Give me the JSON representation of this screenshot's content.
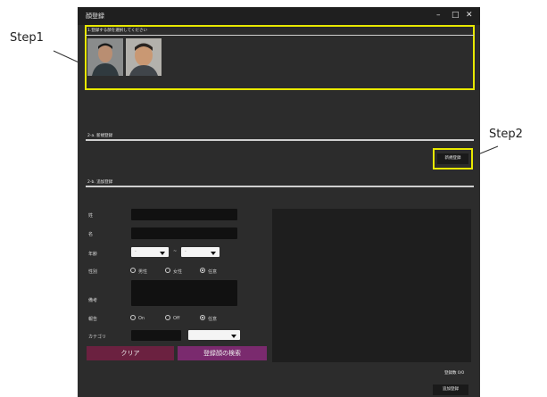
{
  "window": {
    "title": "顔登録",
    "controls": {
      "minimize": "–",
      "maximize": "□",
      "close": "✕"
    }
  },
  "annotations": {
    "step1": "Step1",
    "step2": "Step2",
    "highlight_color": "#e8e800"
  },
  "section1": {
    "label": "1.登録する顔を選択してください",
    "thumbnails": [
      {
        "name": "face-thumbnail-1"
      },
      {
        "name": "face-thumbnail-2"
      }
    ]
  },
  "section2a": {
    "label": "2-a. 新規登録",
    "button": "新規登録"
  },
  "section2b": {
    "label": "2-b. 追加登録"
  },
  "form": {
    "last_name_label": "姓",
    "first_name_label": "名",
    "age_label": "年齢",
    "age_from": "-",
    "age_to": "-",
    "age_sep": "~",
    "gender_label": "性別",
    "gender_options": [
      "男性",
      "女性",
      "任意"
    ],
    "gender_selected": "任意",
    "note_label": "備考",
    "alert_label": "報告",
    "alert_options": [
      "On",
      "Off",
      "任意"
    ],
    "alert_selected": "任意",
    "category_label": "カテゴリ"
  },
  "buttons": {
    "clear": "クリア",
    "search": "登録顔の検索",
    "add": "追加登録"
  },
  "status": {
    "registered_count": "登録数 0/0"
  },
  "colors": {
    "window_bg": "#2c2c2c",
    "clear_btn": "#6b2140",
    "search_btn": "#7a2a6e"
  }
}
